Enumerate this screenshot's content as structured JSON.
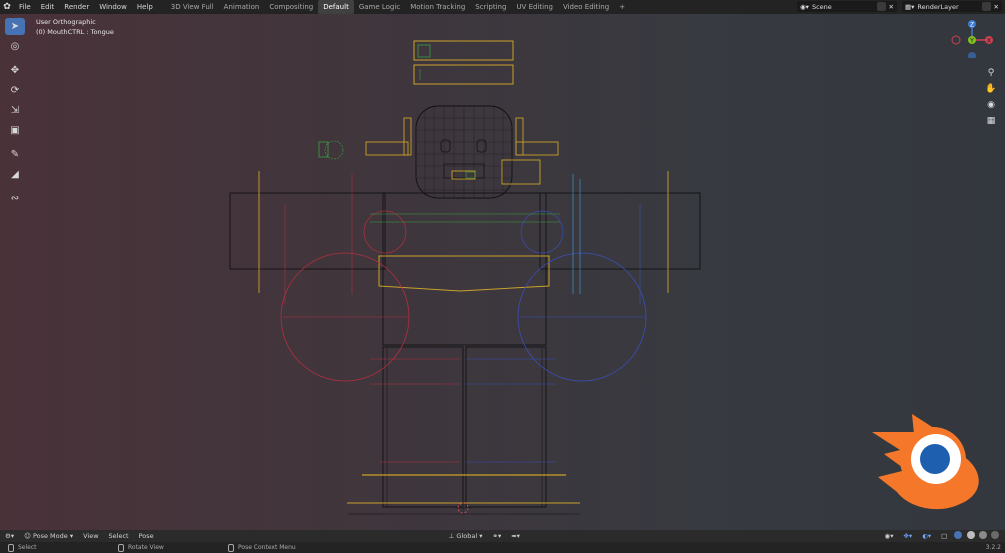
{
  "menu": [
    "File",
    "Edit",
    "Render",
    "Window",
    "Help"
  ],
  "workspaces": [
    "3D View Full",
    "Animation",
    "Compositing",
    "Default",
    "Game Logic",
    "Motion Tracking",
    "Scripting",
    "UV Editing",
    "Video Editing"
  ],
  "active_workspace": "Default",
  "add_workspace": "+",
  "scene_field": "Scene",
  "render_layer_field": "RenderLayer",
  "viewport": {
    "view_name": "User Orthographic",
    "active_object": "(0) MouthCTRL : Tongue"
  },
  "gizmo_axes": {
    "x": "X",
    "y": "Y",
    "z": "Z"
  },
  "bottom_header": {
    "mode": "Pose Mode",
    "menus": [
      "View",
      "Select",
      "Pose"
    ],
    "transform_orientation": "Global"
  },
  "status": {
    "select": "Select",
    "rotate": "Rotate View",
    "context": "Pose Context Menu",
    "version": "3.2.2"
  },
  "colors": {
    "accent": "#4772b3",
    "bone_yellow": "#c9a12a",
    "bone_red": "#b03040",
    "bone_blue": "#3b4fb5",
    "bone_green": "#3aa043"
  },
  "icons": [
    "blender-icon",
    "select-box-icon",
    "cursor-icon",
    "move-icon",
    "rotate-icon",
    "scale-icon",
    "transform-icon",
    "annotate-icon",
    "measure-icon",
    "bone-envelope-icon",
    "zoom-icon",
    "hand-icon",
    "camera-icon",
    "grid-icon"
  ]
}
